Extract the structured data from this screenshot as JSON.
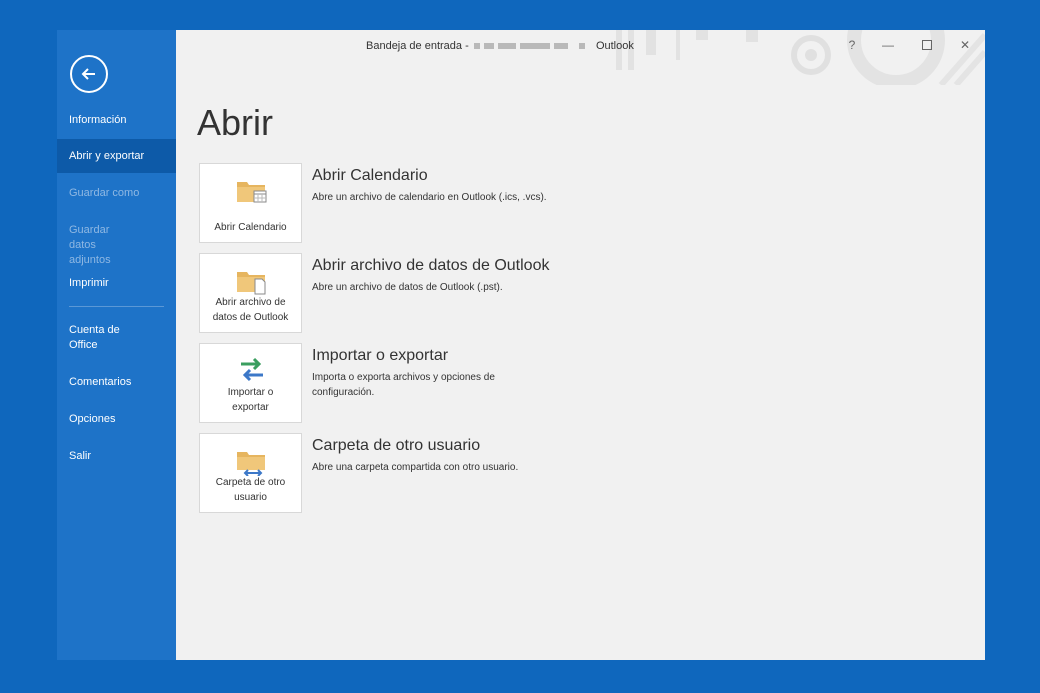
{
  "colors": {
    "background": "#0f67bd",
    "sidebar": "#1e73c8",
    "sidebar_active": "#0d5aa8",
    "sidebar_disabled_text": "#8fb8e3",
    "content": "#f1f1f1"
  },
  "window": {
    "title_prefix": "Bandeja de entrada -",
    "title_app": "Outlook",
    "help_label": "?",
    "minimize_label": "—",
    "close_label": "✕"
  },
  "sidebar": {
    "items": [
      {
        "label": "Información",
        "state": "normal"
      },
      {
        "label": "Abrir y exportar",
        "state": "active"
      },
      {
        "label": "Guardar como",
        "state": "disabled"
      },
      {
        "label": "Guardar datos adjuntos",
        "state": "disabled"
      },
      {
        "label": "Imprimir",
        "state": "normal"
      },
      {
        "label": "Cuenta de Office",
        "state": "normal"
      },
      {
        "label": "Comentarios",
        "state": "normal"
      },
      {
        "label": "Opciones",
        "state": "normal"
      },
      {
        "label": "Salir",
        "state": "normal"
      }
    ]
  },
  "main": {
    "heading": "Abrir",
    "options": [
      {
        "tile_label": "Abrir Calendario",
        "title": "Abrir Calendario",
        "description": "Abre un archivo de calendario en Outlook (.ics, .vcs).",
        "icon": "folder-calendar-icon"
      },
      {
        "tile_label": "Abrir archivo de datos de Outlook",
        "title": "Abrir archivo de datos de Outlook",
        "description": "Abre un archivo de datos de Outlook (.pst).",
        "icon": "folder-file-icon"
      },
      {
        "tile_label": "Importar o exportar",
        "title": "Importar o exportar",
        "description": "Importa o exporta archivos y opciones de configuración.",
        "icon": "import-export-arrows-icon"
      },
      {
        "tile_label": "Carpeta de otro usuario",
        "title": "Carpeta de otro usuario",
        "description": "Abre una carpeta compartida con otro usuario.",
        "icon": "shared-folder-icon"
      }
    ]
  }
}
